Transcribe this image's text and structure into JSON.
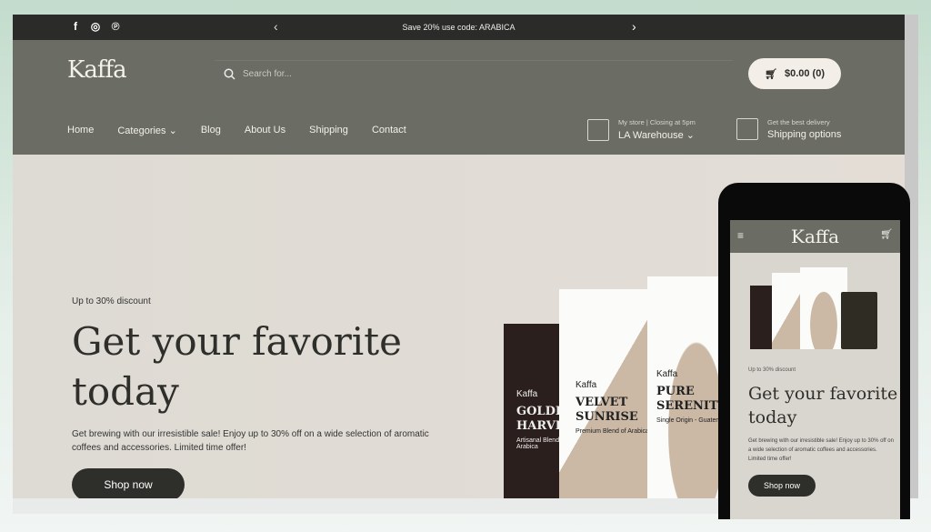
{
  "topbar": {
    "promo": "Save 20% use code: ARABICA",
    "social": [
      "facebook-icon",
      "instagram-icon",
      "pinterest-icon"
    ]
  },
  "header": {
    "logo": "Kaffa",
    "search_placeholder": "Search for...",
    "cart": "$0.00 (0)"
  },
  "nav": [
    "Home",
    "Categories",
    "Blog",
    "About Us",
    "Shipping",
    "Contact"
  ],
  "store": {
    "label": "My store | Closing at 5pm",
    "value": "LA Warehouse"
  },
  "delivery": {
    "label": "Get the best delivery",
    "value": "Shipping options"
  },
  "hero": {
    "discount": "Up to 30% discount",
    "title": "Get your favorite today",
    "description": "Get brewing with our irresistible sale! Enjoy up to 30% off on a wide selection of aromatic coffees and accessories. Limited time offer!",
    "button": "Shop now"
  },
  "products": [
    {
      "brand": "Kaffa",
      "name": "GOLDEN HARVEST",
      "sub": "Artisanal Blend of Arabica"
    },
    {
      "brand": "Kaffa",
      "name": "VELVET SUNRISE",
      "sub": "Premium Blend of Arabica"
    },
    {
      "brand": "Kaffa",
      "name": "PURE SERENITY",
      "sub": "Single Origin - Guatemala"
    }
  ],
  "colors": {
    "topbar": "#2b2b29",
    "header": "#6b6c63",
    "hero": "#dedbd5",
    "button": "#2e2e2b"
  }
}
